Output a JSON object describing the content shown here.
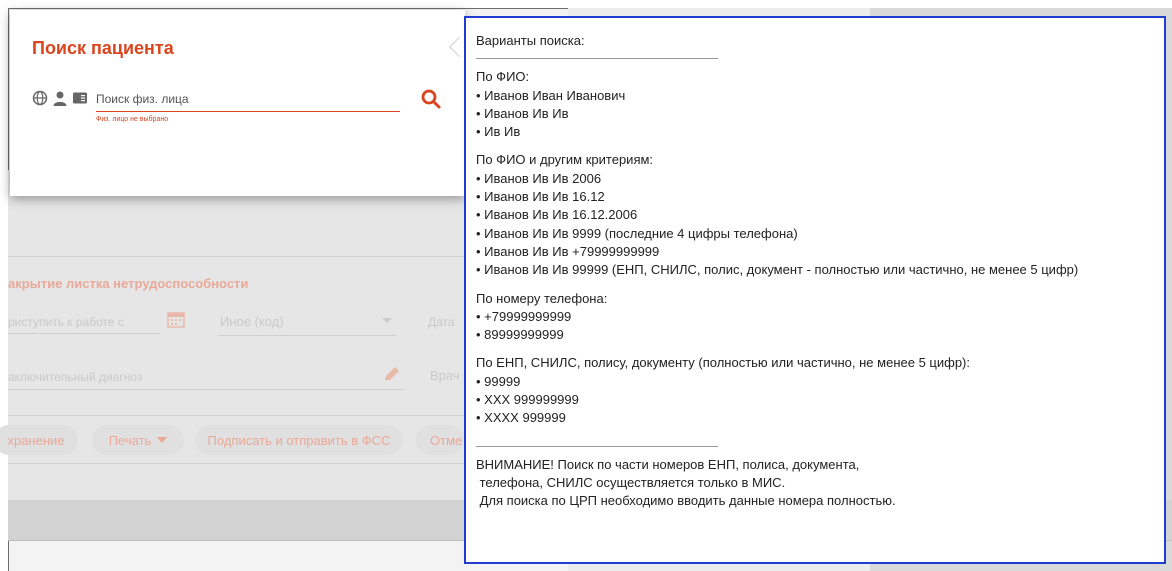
{
  "search_card": {
    "title": "Поиск пациента",
    "placeholder": "Поиск физ. лица",
    "error": "Физ. лицо не выбрано"
  },
  "background_form": {
    "section_title": "акрытие листка нетрудоспособности",
    "field_return_work": "риступить к работе с",
    "select_other": "Иное (код)",
    "field_date": "Дата",
    "field_diagnosis": "аключительный диагноз",
    "field_doctor": "Врач",
    "buttons": {
      "save": "хранение",
      "print": "Печать",
      "sign_send": "Подписать и отправить в ФСС",
      "cancel": "Отме"
    }
  },
  "tooltip": {
    "header": "Варианты поиска:",
    "sections": [
      {
        "title": "По ФИО:",
        "items": [
          "• Иванов Иван Иванович",
          "• Иванов Ив Ив",
          "• Ив Ив"
        ]
      },
      {
        "title": "По ФИО и другим критериям:",
        "items": [
          "• Иванов Ив Ив 2006",
          "• Иванов Ив Ив 16.12",
          "• Иванов Ив Ив 16.12.2006",
          "• Иванов Ив Ив 9999 (последние 4 цифры телефона)",
          "• Иванов Ив Ив +79999999999",
          "• Иванов Ив Ив 99999 (ЕНП, СНИЛС, полис, документ - полностью или частично, не менее 5 цифр)"
        ]
      },
      {
        "title": "По номеру телефона:",
        "items": [
          "• +79999999999",
          "• 89999999999"
        ]
      },
      {
        "title": "По ЕНП, СНИЛС, полису, документу (полностью или частично, не менее 5 цифр):",
        "items": [
          "• 99999",
          "• XXX 999999999",
          "• XXXX 999999"
        ]
      }
    ],
    "warning": [
      "ВНИМАНИЕ! Поиск по части номеров ЕНП, полиса, документа,",
      " телефона, СНИЛС осуществляется только в МИС.",
      " Для поиска по ЦРП необходимо вводить данные номера полностью."
    ]
  }
}
